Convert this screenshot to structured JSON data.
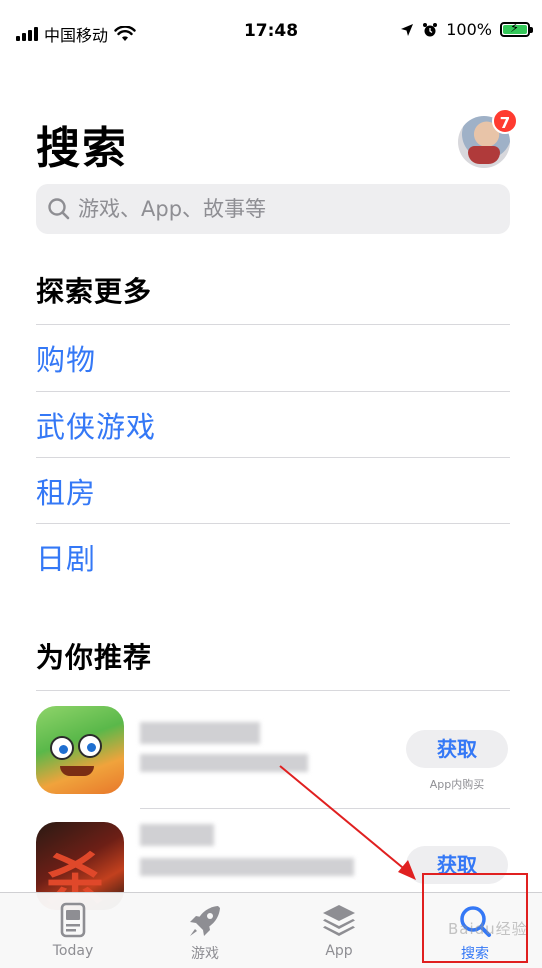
{
  "status_bar": {
    "carrier": "中国移动",
    "time": "17:48",
    "battery_percent": "100%"
  },
  "header": {
    "title": "搜索",
    "avatar_badge": "7"
  },
  "search": {
    "placeholder": "游戏、App、故事等"
  },
  "explore": {
    "title": "探索更多",
    "items": [
      {
        "label": "购物"
      },
      {
        "label": "武侠游戏"
      },
      {
        "label": "租房"
      },
      {
        "label": "日剧"
      }
    ]
  },
  "recommended": {
    "title": "为你推荐",
    "apps": [
      {
        "get_label": "获取",
        "note": "App内购买"
      },
      {
        "get_label": "获取",
        "note": ""
      }
    ]
  },
  "tab_bar": {
    "tabs": [
      {
        "label": "Today",
        "icon": "today-icon"
      },
      {
        "label": "游戏",
        "icon": "rocket-icon"
      },
      {
        "label": "App",
        "icon": "layers-icon"
      },
      {
        "label": "搜索",
        "icon": "search-icon",
        "active": true
      }
    ]
  },
  "colors": {
    "accent": "#3478f6",
    "badge": "#ff3b30",
    "annotation": "#e02020",
    "battery": "#34c759"
  }
}
